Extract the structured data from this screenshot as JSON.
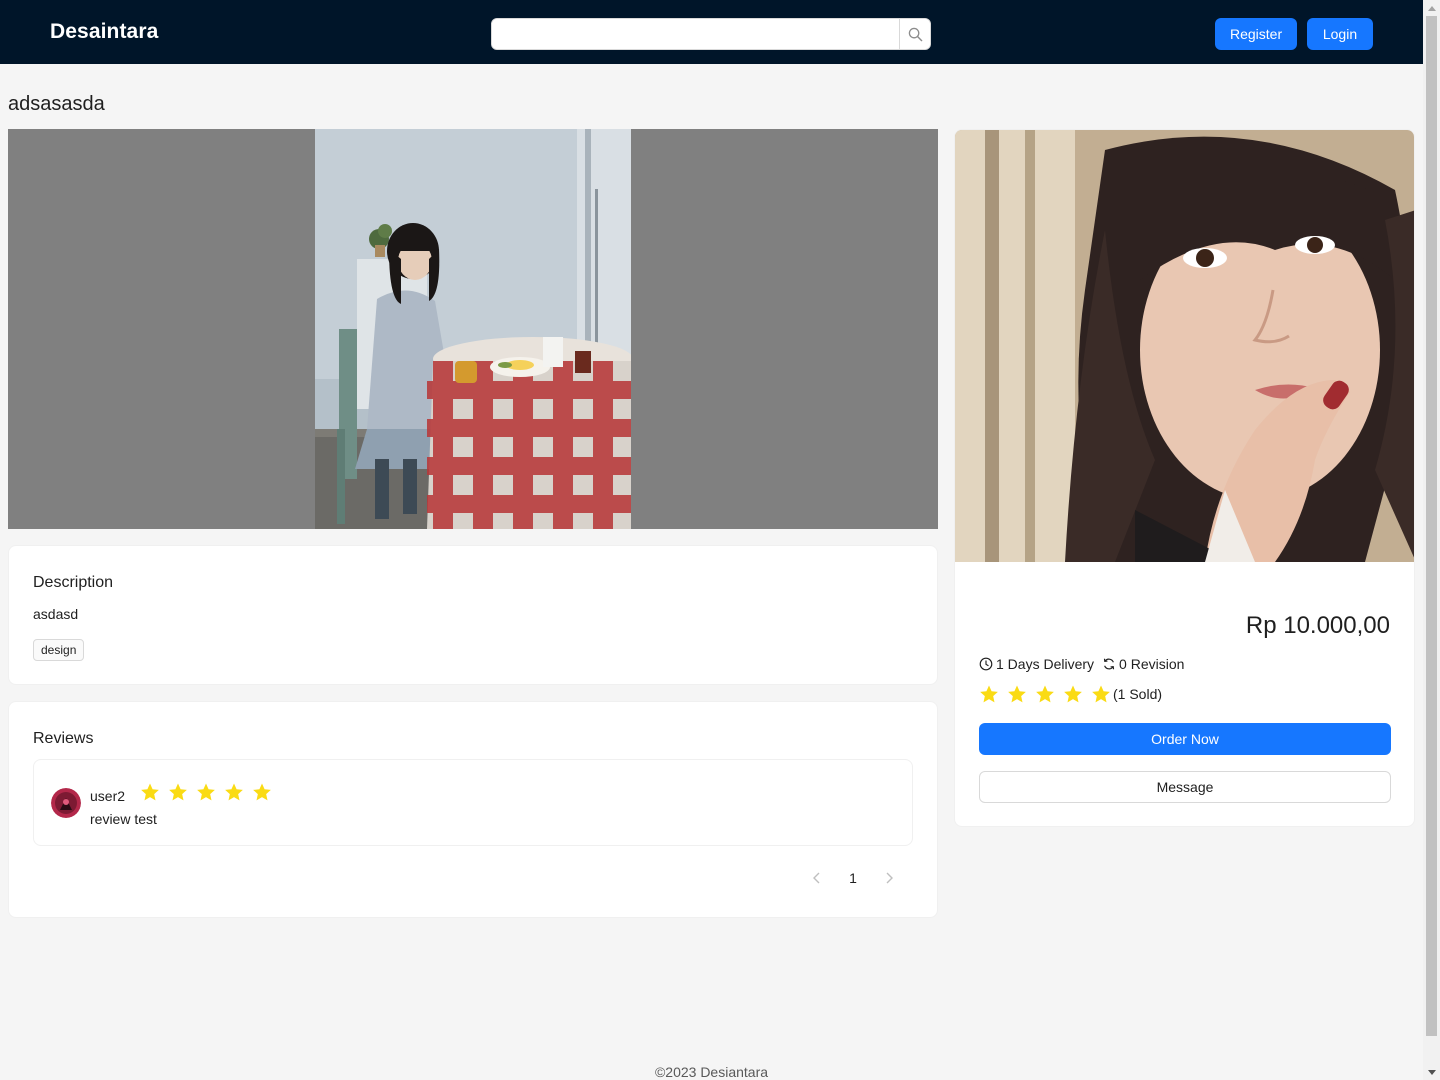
{
  "header": {
    "brand": "Desaintara",
    "search": {
      "value": "",
      "placeholder": ""
    },
    "register_label": "Register",
    "login_label": "Login"
  },
  "gig": {
    "title": "adsasasda",
    "main_image": "photo of a woman sitting at a table with a red checkered tablecloth",
    "side_image": "close-up portrait of a woman with bangs"
  },
  "description": {
    "heading": "Description",
    "text": "asdasd",
    "tags": [
      "design"
    ]
  },
  "reviews": {
    "heading": "Reviews",
    "items": [
      {
        "user": "user2",
        "rating": 5,
        "text": "review test"
      }
    ],
    "pagination": {
      "current": "1"
    }
  },
  "pricing": {
    "price": "Rp 10.000,00",
    "delivery": "1 Days Delivery",
    "revision": "0 Revision",
    "rating": 5,
    "sold": "(1 Sold)",
    "order_label": "Order Now",
    "message_label": "Message"
  },
  "footer": {
    "text": "©2023 Desiantara"
  },
  "colors": {
    "header_bg": "#001529",
    "primary": "#1677ff",
    "star": "#fadb14",
    "page_bg": "#f5f5f5"
  },
  "icons": {
    "search": "search-icon",
    "delivery": "clock-icon",
    "revision": "sync-icon",
    "star": "star-icon",
    "prev": "chevron-left-icon",
    "next": "chevron-right-icon"
  }
}
